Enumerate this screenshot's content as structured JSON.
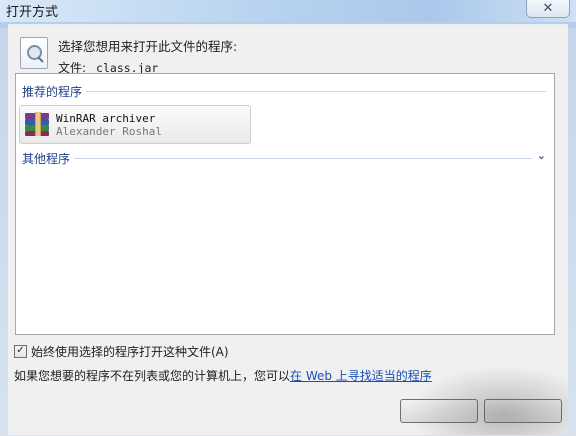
{
  "window": {
    "title": "打开方式",
    "close_label": "✕"
  },
  "header": {
    "prompt": "选择您想用来打开此文件的程序:",
    "file_label": "文件:",
    "file_name": "class.jar"
  },
  "groups": {
    "recommended": "推荐的程序",
    "other": "其他程序"
  },
  "app": {
    "name": "WinRAR archiver",
    "vendor": "Alexander Roshal"
  },
  "always": {
    "label": "始终使用选择的程序打开这种文件(A)",
    "checked": true,
    "mark": "✓"
  },
  "hint": {
    "text": "如果您想要的程序不在列表或您的计算机上，您可以",
    "link": "在 Web 上寻找适当的程序"
  }
}
